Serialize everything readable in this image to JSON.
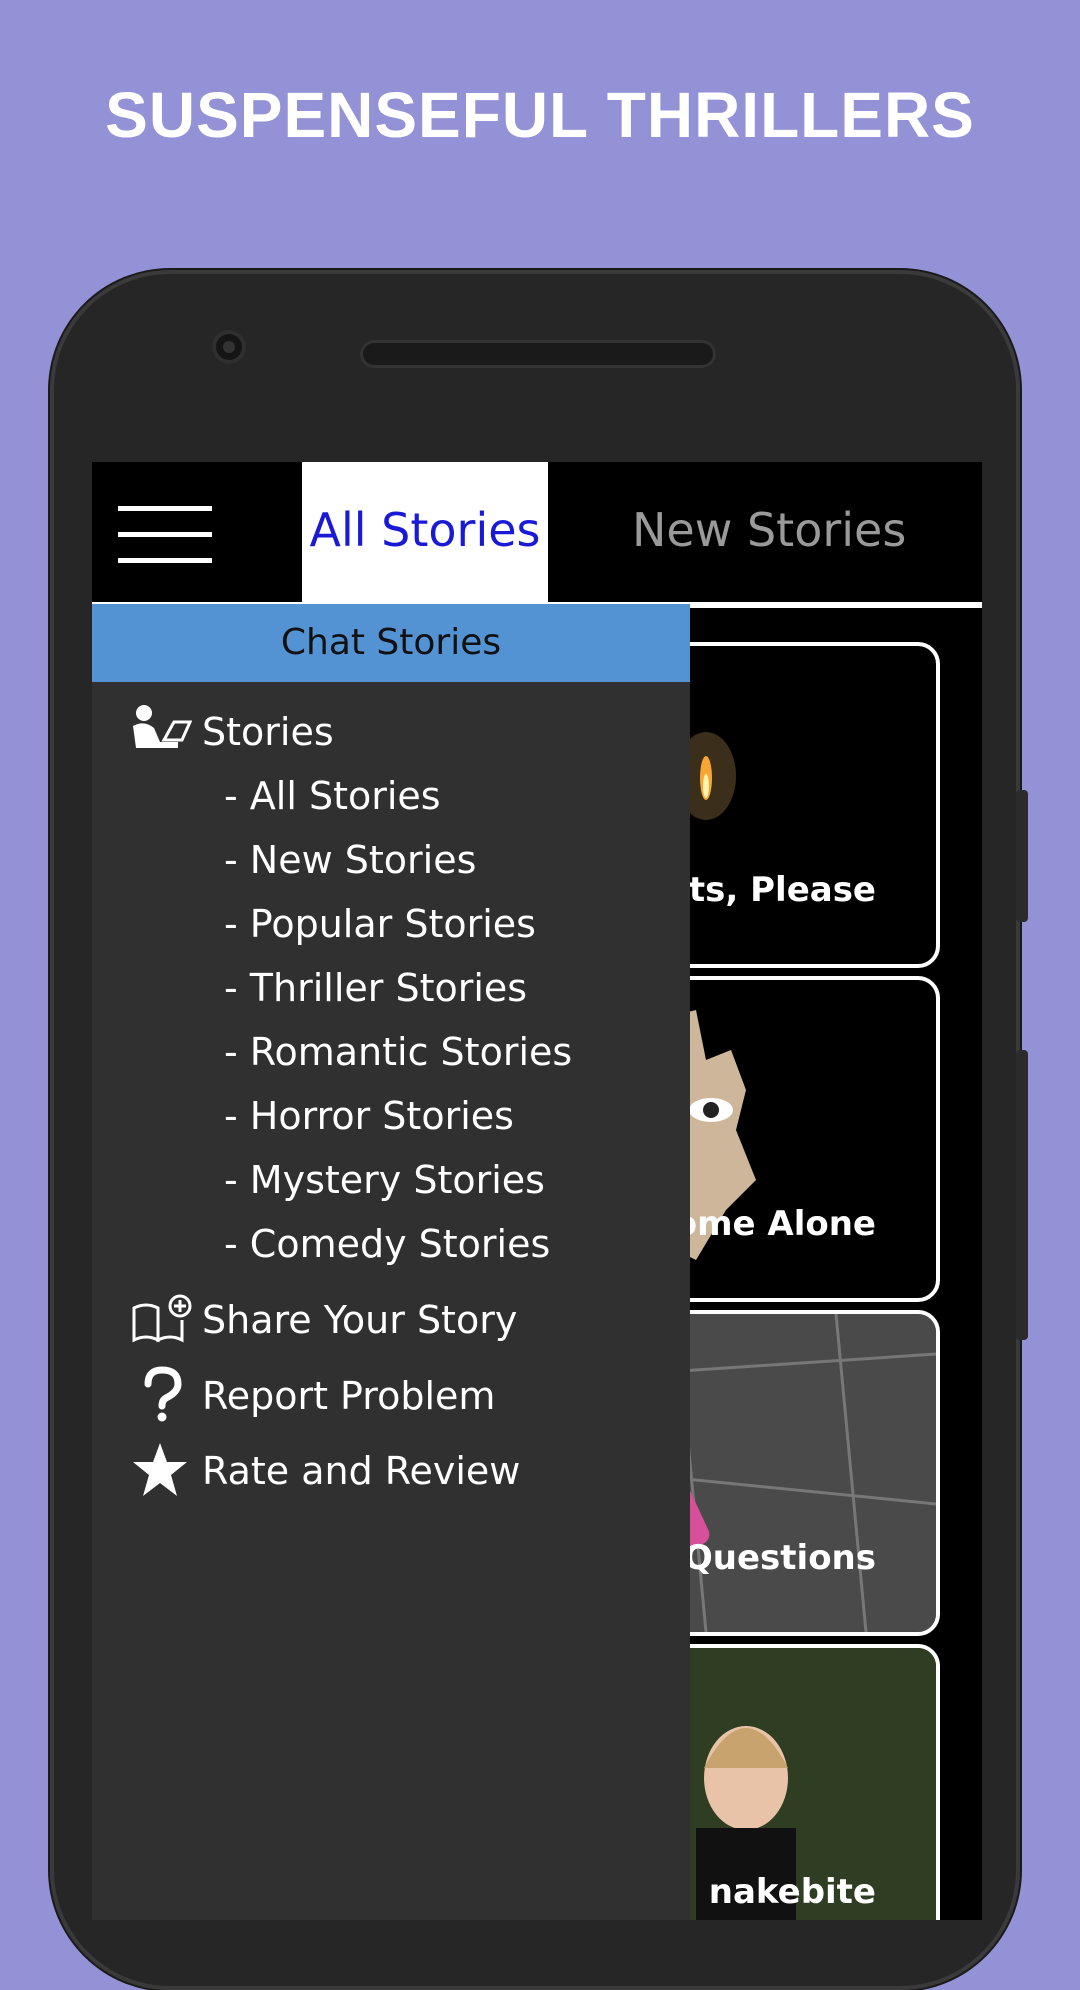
{
  "headline": "SUSPENSEFUL THRILLERS",
  "app": {
    "tabs": {
      "all": "All Stories",
      "new": "New Stories"
    },
    "drawer": {
      "header": "Chat Stories",
      "section_label": "Stories",
      "sub_items": [
        "- All Stories",
        "- New Stories",
        "- Popular Stories",
        "- Thriller Stories",
        "- Romantic Stories",
        "- Horror Stories",
        "- Mystery Stories",
        "- Comedy Stories"
      ],
      "share": "Share Your Story",
      "report": "Report Problem",
      "rate": "Rate and Review"
    },
    "cards": [
      {
        "title": "hts, Please"
      },
      {
        "title": "ome Alone"
      },
      {
        "title": "Questions"
      },
      {
        "title": "nakebite"
      }
    ]
  },
  "icons": [
    "menu-icon",
    "reader-icon",
    "book-plus-icon",
    "question-icon",
    "star-icon"
  ],
  "colors": {
    "background": "#9492d6",
    "drawer": "#303030",
    "header": "#5393d4",
    "tab_active_text": "#1a1ad6"
  }
}
